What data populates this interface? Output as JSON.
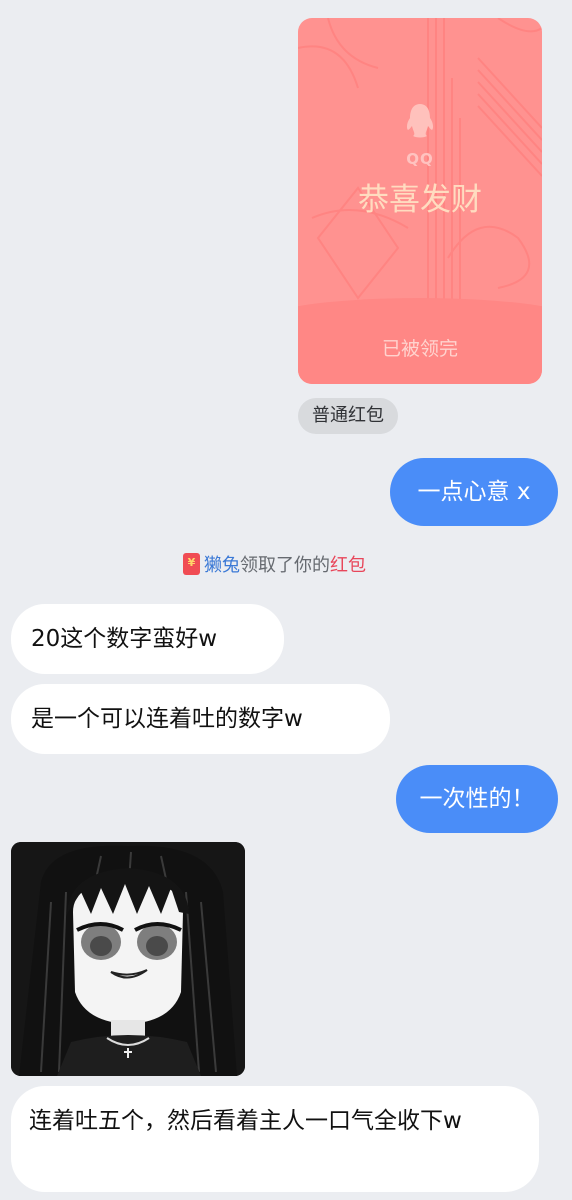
{
  "red_packet": {
    "brand": "QQ",
    "greeting": "恭喜发财",
    "status": "已被领完",
    "type_label": "普通红包"
  },
  "notice": {
    "icon": "red-packet-icon",
    "icon_glyph": "¥",
    "user": "獭兔",
    "action": "领取了你的",
    "object": "红包"
  },
  "messages": [
    {
      "side": "out",
      "text": "一点心意 x"
    },
    {
      "side": "in",
      "text": "20这个数字蛮好w"
    },
    {
      "side": "in",
      "text": "是一个可以连着吐的数字w"
    },
    {
      "side": "out",
      "text": "一次性的！"
    },
    {
      "side": "in",
      "type": "sticker",
      "sticker": "anime-girl-sticker"
    },
    {
      "side": "in",
      "text": "连着吐五个，然后看着主人一口气全收下w"
    }
  ],
  "colors": {
    "background": "#ebedf1",
    "outgoing_bubble": "#4a8df8",
    "incoming_bubble": "#ffffff",
    "red_packet": "#ff9290",
    "notice_name": "#3b79d6",
    "notice_packet": "#e8465a"
  }
}
